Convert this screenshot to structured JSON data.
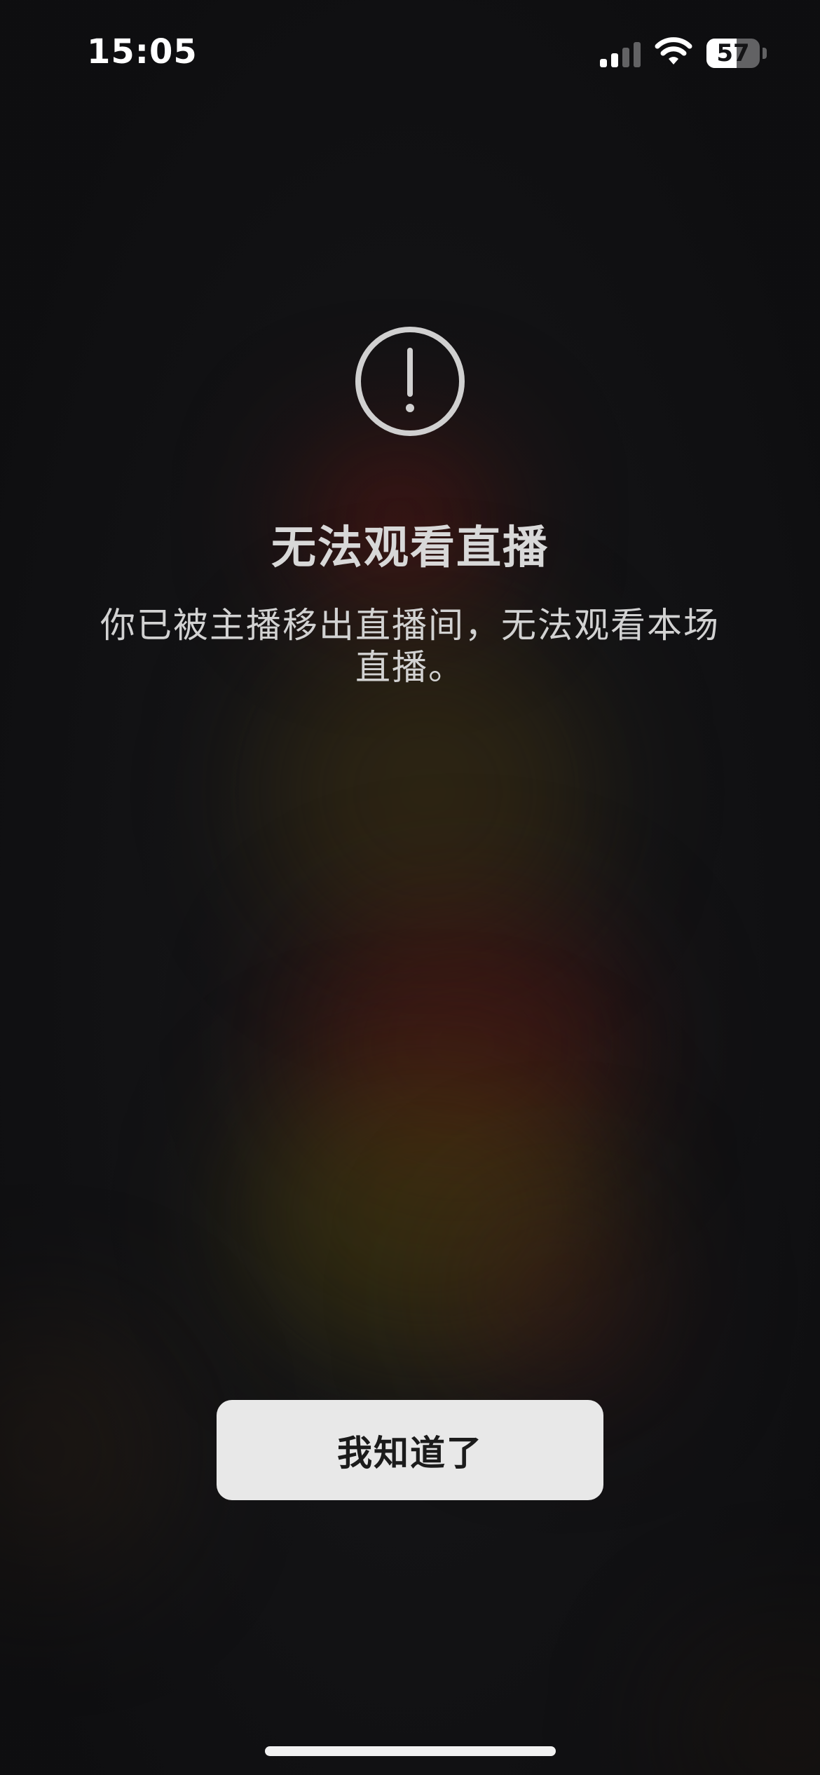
{
  "status_bar": {
    "time": "15:05",
    "battery_level": "57",
    "battery_fraction": 0.57,
    "signal_bars_active": 2,
    "signal_bars_total": 4
  },
  "alert": {
    "icon": "exclamation-circle-icon",
    "title": "无法观看直播",
    "message": "你已被主播移出直播间，无法观看本场直播。"
  },
  "actions": {
    "confirm_label": "我知道了"
  },
  "colors": {
    "background": "#141416",
    "button_bg": "#e8e8e8",
    "button_text": "#1b1b1b",
    "title_text": "#d8d8d8",
    "icon_stroke": "#d0d0d0"
  }
}
